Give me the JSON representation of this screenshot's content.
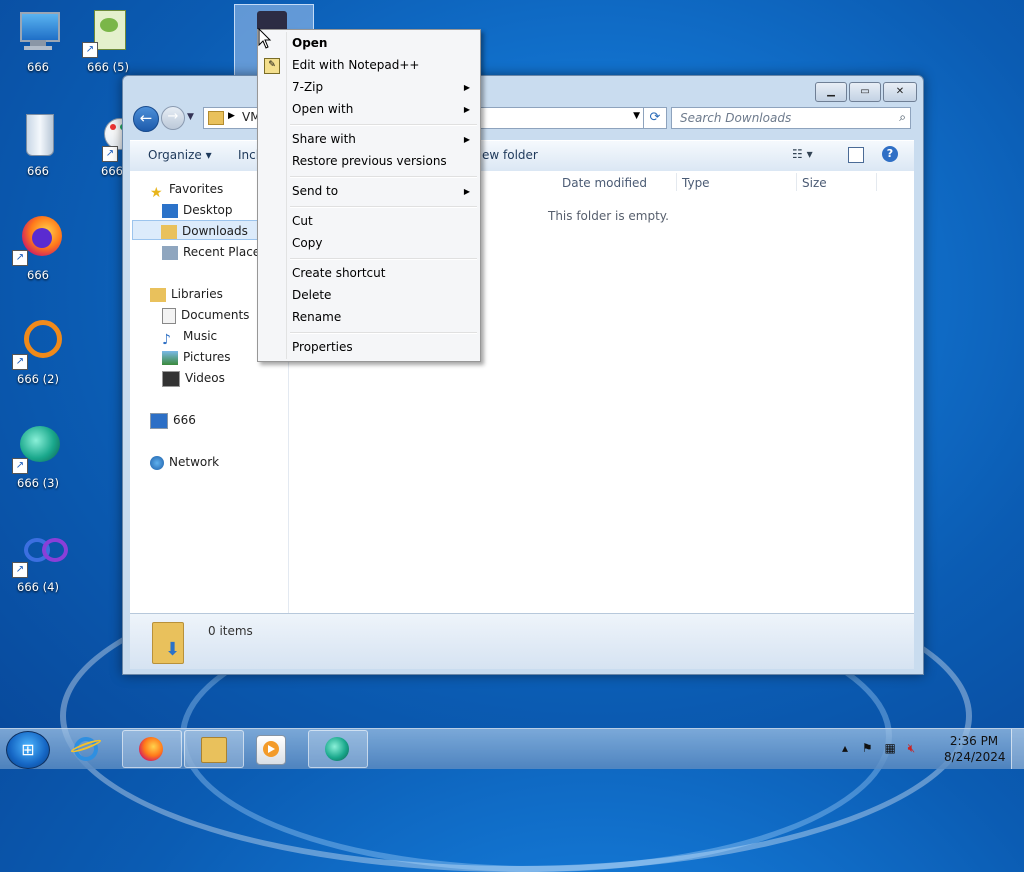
{
  "desktop": {
    "icons": [
      {
        "label": "666",
        "icon": "computer-icon"
      },
      {
        "label": "666 (5)",
        "icon": "notepad-plus-plus-icon"
      },
      {
        "label": "666",
        "icon": "recycle-bin-icon"
      },
      {
        "label": "666",
        "icon": "paint-icon"
      },
      {
        "label": "666",
        "icon": "firefox-icon"
      },
      {
        "label": "666 (2)",
        "icon": "orange-ring-icon"
      },
      {
        "label": "666 (3)",
        "icon": "teal-app-icon"
      },
      {
        "label": "666 (4)",
        "icon": "infinity-icon"
      }
    ]
  },
  "explorer": {
    "address": "VM",
    "search_placeholder": "Search Downloads",
    "toolbar": {
      "organize": "Organize ▾",
      "include": "Incl",
      "new_folder": "ew folder"
    },
    "nav": {
      "favorites": "Favorites",
      "desktop": "Desktop",
      "downloads": "Downloads",
      "recent": "Recent Places",
      "libraries": "Libraries",
      "documents": "Documents",
      "music": "Music",
      "pictures": "Pictures",
      "videos": "Videos",
      "computer": "666",
      "network": "Network"
    },
    "columns": {
      "date": "Date modified",
      "type": "Type",
      "size": "Size"
    },
    "empty_text": "This folder is empty.",
    "item_count": "0 items"
  },
  "context_menu": {
    "open": "Open",
    "edit_notepad": "Edit with Notepad++",
    "zip": "7-Zip",
    "open_with": "Open with",
    "share_with": "Share with",
    "restore": "Restore previous versions",
    "send_to": "Send to",
    "cut": "Cut",
    "copy": "Copy",
    "create_shortcut": "Create shortcut",
    "delete": "Delete",
    "rename": "Rename",
    "properties": "Properties"
  },
  "taskbar": {
    "time": "2:36 PM",
    "date": "8/24/2024",
    "apps": [
      "internet-explorer-icon",
      "firefox-icon",
      "file-explorer-icon",
      "media-player-icon",
      "teal-app-icon"
    ]
  }
}
